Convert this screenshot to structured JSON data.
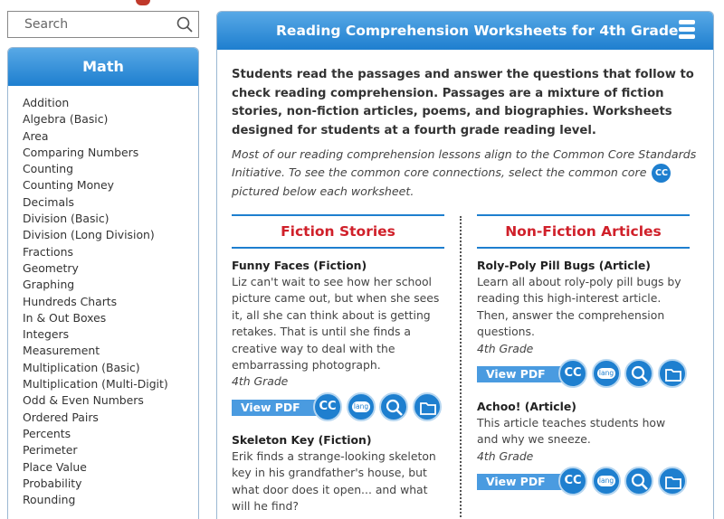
{
  "search": {
    "placeholder": "Search"
  },
  "sidebar": {
    "title": "Math",
    "items": [
      "Addition",
      "Algebra (Basic)",
      "Area",
      "Comparing Numbers",
      "Counting",
      "Counting Money",
      "Decimals",
      "Division (Basic)",
      "Division (Long Division)",
      "Fractions",
      "Geometry",
      "Graphing",
      "Hundreds Charts",
      "In & Out Boxes",
      "Integers",
      "Measurement",
      "Multiplication (Basic)",
      "Multiplication (Multi-Digit)",
      "Odd & Even Numbers",
      "Ordered Pairs",
      "Percents",
      "Perimeter",
      "Place Value",
      "Probability",
      "Rounding"
    ]
  },
  "main": {
    "title": "Reading Comprehension Worksheets for 4th Grade",
    "intro": "Students read the passages and answer the questions that follow to check reading comprehension. Passages are a mixture of fiction stories, non-fiction articles, poems, and biographies. Worksheets designed for students at a fourth grade reading level.",
    "intro2_a": "Most of our reading comprehension lessons align to the Common Core Standards Initiative. To see the common core connections, select the common core",
    "intro2_b": "pictured below each worksheet.",
    "cc_label": "CC"
  },
  "buttons": {
    "view_pdf": "View PDF",
    "cc": "CC",
    "lang": "lang"
  },
  "fiction": {
    "heading": "Fiction Stories",
    "items": [
      {
        "title": "Funny Faces (Fiction)",
        "desc": "Liz can't wait to see how her school picture came out, but when she sees it, all she can think about is getting retakes. That is until she finds a creative way to deal with the embarrassing photograph.",
        "grade": "4th Grade"
      },
      {
        "title": "Skeleton Key (Fiction)",
        "desc": "Erik finds a strange-looking skeleton key in his grandfather's house, but what door does it open... and what will he find?"
      }
    ]
  },
  "nonfiction": {
    "heading": "Non-Fiction Articles",
    "items": [
      {
        "title": "Roly-Poly Pill Bugs (Article)",
        "desc": "Learn all about roly-poly pill bugs by reading this high-interest article. Then, answer the comprehension questions.",
        "grade": "4th Grade"
      },
      {
        "title": "Achoo! (Article)",
        "desc": "This article teaches students how and why we sneeze.",
        "grade": "4th Grade"
      }
    ]
  }
}
